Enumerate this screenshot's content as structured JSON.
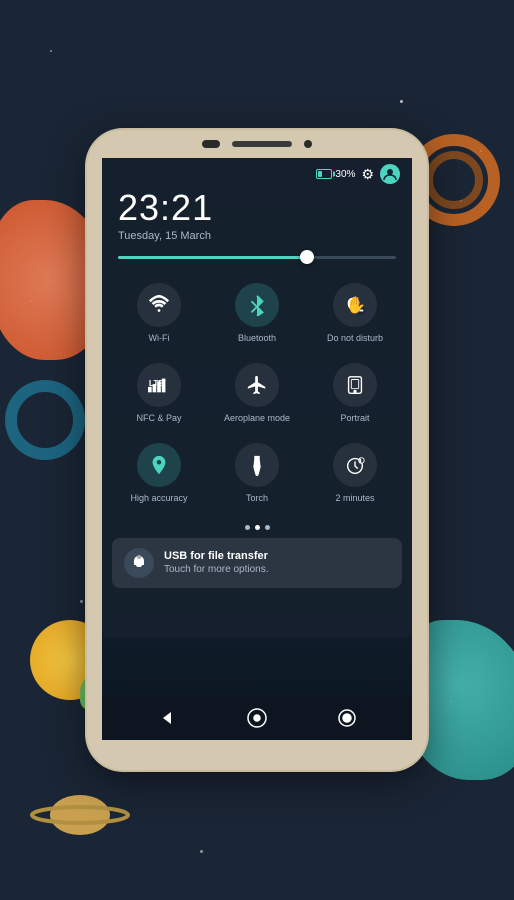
{
  "background": {
    "color": "#1a2535"
  },
  "status_bar": {
    "battery_pct": "30%",
    "time": "23:21",
    "date": "Tuesday, 15 March"
  },
  "quick_settings": {
    "items": [
      {
        "id": "wifi",
        "label": "Wi-Fi",
        "active": false,
        "icon": "wifi"
      },
      {
        "id": "bluetooth",
        "label": "Bluetooth",
        "active": true,
        "icon": "bluetooth"
      },
      {
        "id": "dnd",
        "label": "Do not disturb",
        "active": false,
        "icon": "hand"
      },
      {
        "id": "lte",
        "label": "NFC & Pay",
        "active": false,
        "icon": "lte"
      },
      {
        "id": "airplane",
        "label": "Aeroplane mode",
        "active": false,
        "icon": "airplane"
      },
      {
        "id": "portrait",
        "label": "Portrait",
        "active": false,
        "icon": "portrait"
      },
      {
        "id": "location",
        "label": "High accuracy",
        "active": true,
        "icon": "location"
      },
      {
        "id": "torch",
        "label": "Torch",
        "active": false,
        "icon": "torch"
      },
      {
        "id": "timer",
        "label": "2 minutes",
        "active": false,
        "icon": "timer"
      }
    ]
  },
  "notification": {
    "title": "USB for file transfer",
    "subtitle": "Touch for more options.",
    "app_icon": "usb"
  },
  "bottom_nav": {
    "back_label": "back",
    "home_label": "home",
    "recents_label": "recents"
  },
  "dots": {
    "count": 3,
    "active_index": 1
  }
}
